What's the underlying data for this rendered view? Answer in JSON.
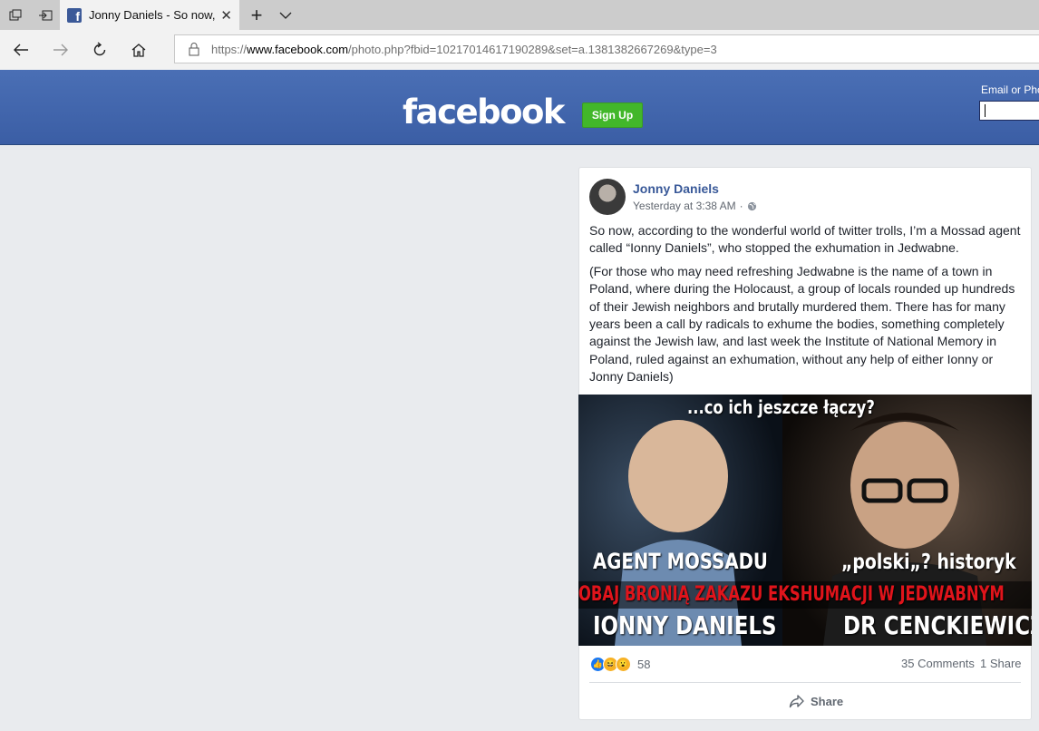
{
  "browser": {
    "tab_title": "Jonny Daniels - So now,",
    "url_prefix": "https://",
    "url_domain": "www.facebook.com",
    "url_path": "/photo.php?fbid=10217014617190289&set=a.1381382667269&type=3",
    "icons": [
      "tab-actions-icon",
      "set-aside-tabs-icon",
      "facebook-favicon-icon",
      "close-icon",
      "new-tab-icon",
      "chevron-down-icon",
      "back-icon",
      "forward-icon",
      "refresh-icon",
      "home-icon",
      "lock-icon"
    ]
  },
  "header": {
    "logo": "facebook",
    "signup_label": "Sign Up",
    "email_label": "Email or Phone",
    "bg_color": "#4267b2",
    "signup_color": "#42b72a"
  },
  "post": {
    "author": "Jonny Daniels",
    "timestamp": "Yesterday at 3:38 AM",
    "meta_separator": "·",
    "paragraph1": "So now, according to the wonderful world of twitter trolls, I’m a Mossad agent called “Ionny Daniels”, who stopped the exhumation in Jedwabne.",
    "paragraph2": "(For those who may need refreshing Jedwabne is the name of a town in Poland, where during the Holocaust, a group of locals rounded up hundreds of their Jewish neighbors and brutally murdered them. There has for many years been a call by radicals to exhume the bodies, something completely against the Jewish law, and last week the Institute of National Memory in Poland, ruled against an exhumation, without any help of either Ionny or Jonny Daniels)",
    "meme": {
      "top_text": "...co ich jeszcze łączy?",
      "left_label": "AGENT MOSSADU",
      "right_label": "„polski„? historyk",
      "banner": "OBAJ BRONIĄ ZAKAZU EKSHUMACJI W JEDWABNYM",
      "left_name": "IONNY DANIELS",
      "right_name": "DR CENCKIEWICZ",
      "banner_color": "#e0141b"
    },
    "reaction_count": "58",
    "comments": "35 Comments",
    "shares": "1 Share",
    "share_label": "Share"
  }
}
